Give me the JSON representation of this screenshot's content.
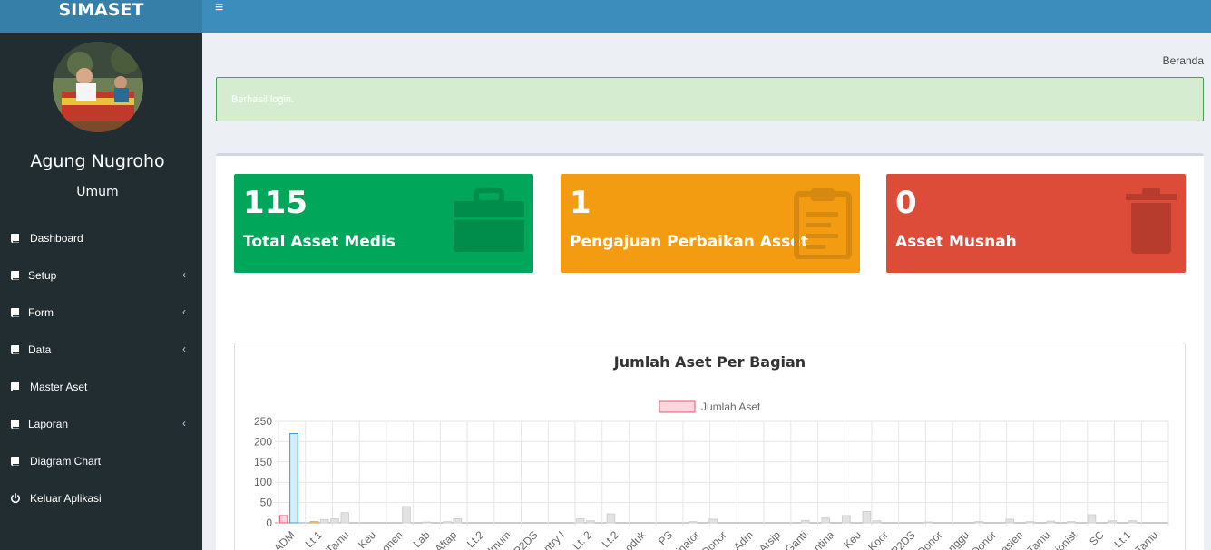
{
  "app": {
    "brand": "SIMASET",
    "menu_toggle": "≡"
  },
  "user": {
    "name": "Agung Nugroho",
    "role": "Umum"
  },
  "sidebar": {
    "items": [
      {
        "label": "Dashboard",
        "icon": "book-icon",
        "has_submenu": false
      },
      {
        "label": "Setup",
        "icon": "book-icon",
        "has_submenu": true
      },
      {
        "label": "Form",
        "icon": "book-icon",
        "has_submenu": true
      },
      {
        "label": "Data",
        "icon": "book-icon",
        "has_submenu": true
      },
      {
        "label": "Master Aset",
        "icon": "book-icon",
        "has_submenu": false
      },
      {
        "label": "Laporan",
        "icon": "book-icon",
        "has_submenu": true
      },
      {
        "label": "Diagram Chart",
        "icon": "book-icon",
        "has_submenu": false
      },
      {
        "label": "Keluar Aplikasi",
        "icon": "power-icon",
        "has_submenu": false
      }
    ]
  },
  "breadcrumb": "Beranda",
  "alert": "Berhasil login.",
  "tiles": [
    {
      "value": "115",
      "label": "Total Asset Medis",
      "color": "#00a65a",
      "icon": "briefcase-icon"
    },
    {
      "value": "1",
      "label": "Pengajuan Perbaikan Asset",
      "color": "#f39c12",
      "icon": "clipboard-icon"
    },
    {
      "value": "0",
      "label": "Asset Musnah",
      "color": "#dd4b39",
      "icon": "trash-icon"
    }
  ],
  "chart_data": {
    "type": "bar",
    "title": "Jumlah Aset Per Bagian",
    "legend": {
      "label": "Jumlah Aset",
      "position": "top"
    },
    "ylim": [
      0,
      250
    ],
    "yticks": [
      "250",
      "200",
      "150",
      "100",
      "50",
      "0"
    ],
    "grid": true,
    "categories": [
      "ADM",
      "Lt.1",
      "Tamu",
      "Keu",
      "onen",
      "Lab",
      "Aftap",
      "Lt.2",
      "Umum",
      "P2DS",
      "ntry I",
      "Lt. 2",
      "Lt.2",
      "oduk",
      "PS",
      "inator",
      "Donor",
      "Adm",
      "Arsip",
      "Ganti",
      "ntina",
      "Keu",
      "Koor",
      "P2DS",
      "Donor",
      "nggu",
      "Donor",
      "asien",
      "Tamu",
      "sionist",
      "SC",
      "Lt.1",
      "Tamu"
    ],
    "values": [
      18,
      220,
      0,
      3,
      8,
      10,
      25,
      0,
      0,
      0,
      0,
      0,
      40,
      0,
      2,
      0,
      3,
      10,
      0,
      0,
      0,
      0,
      0,
      0,
      0,
      0,
      0,
      0,
      0,
      10,
      5,
      0,
      22,
      0,
      0,
      0,
      0,
      0,
      0,
      0,
      3,
      0,
      9,
      0,
      0,
      0,
      0,
      0,
      0,
      0,
      0,
      6,
      0,
      12,
      0,
      18,
      0,
      28,
      5,
      0,
      0,
      0,
      0,
      2,
      0,
      0,
      0,
      0,
      3,
      0,
      0,
      9,
      0,
      3,
      0,
      4,
      0,
      3,
      0,
      20,
      0,
      5,
      0,
      5,
      0,
      0,
      0
    ],
    "bar_colors": {
      "first": "#ffd6dd",
      "second": "#d5ecf9",
      "other": "#e2e2e2"
    }
  }
}
